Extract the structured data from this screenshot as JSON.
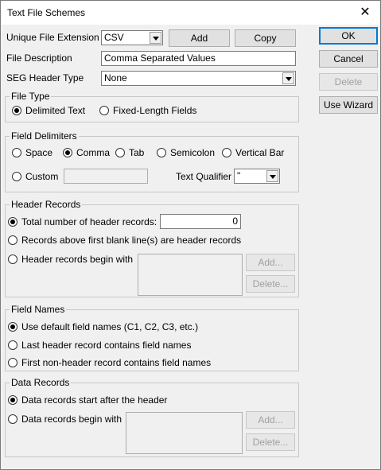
{
  "window": {
    "title": "Text File Schemes",
    "close_glyph": "✕"
  },
  "top": {
    "unique_ext_label": "Unique File Extension",
    "unique_ext_value": "CSV",
    "add_label": "Add",
    "copy_label": "Copy",
    "file_desc_label": "File Description",
    "file_desc_value": "Comma Separated Values",
    "seg_header_label": "SEG Header Type",
    "seg_header_value": "None"
  },
  "side_buttons": {
    "ok": "OK",
    "cancel": "Cancel",
    "delete": "Delete",
    "wizard": "Use Wizard"
  },
  "file_type": {
    "title": "File Type",
    "options": [
      "Delimited Text",
      "Fixed-Length Fields"
    ],
    "selected": "Delimited Text"
  },
  "field_delimiters": {
    "title": "Field Delimiters",
    "options": [
      "Space",
      "Comma",
      "Tab",
      "Semicolon",
      "Vertical Bar",
      "Custom"
    ],
    "selected": "Comma",
    "custom_value": "",
    "text_qualifier_label": "Text Qualifier",
    "text_qualifier_value": "\""
  },
  "header_records": {
    "title": "Header Records",
    "opt_total": "Total number of header records:",
    "total_value": "0",
    "opt_blank": "Records above first blank line(s) are header records",
    "opt_begin": "Header records begin with",
    "add_label": "Add...",
    "delete_label": "Delete...",
    "selected": "total"
  },
  "field_names": {
    "title": "Field Names",
    "options": [
      "Use default field names (C1, C2, C3, etc.)",
      "Last header record contains field names",
      "First non-header record contains field names"
    ],
    "selected": 0
  },
  "data_records": {
    "title": "Data Records",
    "opt_after": "Data records start after the header",
    "opt_begin": "Data records begin with",
    "add_label": "Add...",
    "delete_label": "Delete...",
    "selected": "after"
  }
}
